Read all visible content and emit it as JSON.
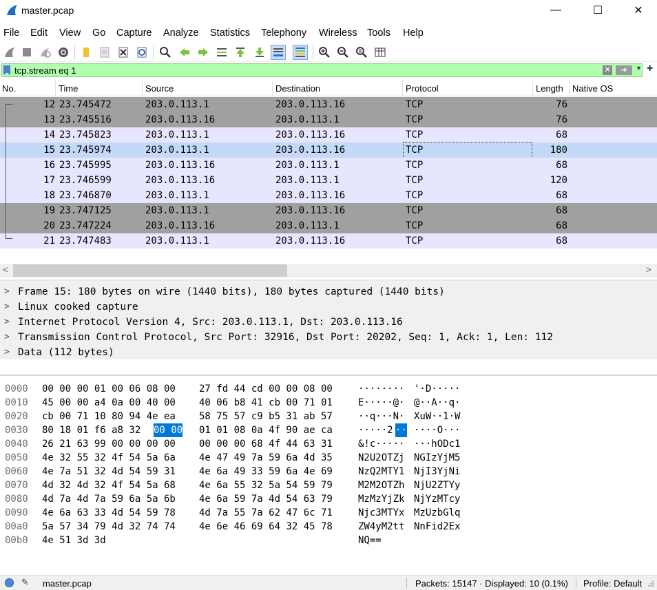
{
  "window": {
    "title": "master.pcap",
    "minimize": "—",
    "maximize": "☐",
    "close": "✕"
  },
  "menu": [
    "File",
    "Edit",
    "View",
    "Go",
    "Capture",
    "Analyze",
    "Statistics",
    "Telephony",
    "Wireless",
    "Tools",
    "Help"
  ],
  "filter": {
    "value": "tcp.stream eq 1"
  },
  "columns": [
    "No.",
    "Time",
    "Source",
    "Destination",
    "Protocol",
    "Length",
    "Native OS"
  ],
  "packets": [
    {
      "no": "12",
      "time": "23.745472",
      "src": "203.0.113.1",
      "dst": "203.0.113.16",
      "proto": "TCP",
      "len": "76"
    },
    {
      "no": "13",
      "time": "23.745516",
      "src": "203.0.113.16",
      "dst": "203.0.113.1",
      "proto": "TCP",
      "len": "76"
    },
    {
      "no": "14",
      "time": "23.745823",
      "src": "203.0.113.1",
      "dst": "203.0.113.16",
      "proto": "TCP",
      "len": "68"
    },
    {
      "no": "15",
      "time": "23.745974",
      "src": "203.0.113.1",
      "dst": "203.0.113.16",
      "proto": "TCP",
      "len": "180"
    },
    {
      "no": "16",
      "time": "23.745995",
      "src": "203.0.113.16",
      "dst": "203.0.113.1",
      "proto": "TCP",
      "len": "68"
    },
    {
      "no": "17",
      "time": "23.746599",
      "src": "203.0.113.16",
      "dst": "203.0.113.1",
      "proto": "TCP",
      "len": "120"
    },
    {
      "no": "18",
      "time": "23.746870",
      "src": "203.0.113.1",
      "dst": "203.0.113.16",
      "proto": "TCP",
      "len": "68"
    },
    {
      "no": "19",
      "time": "23.747125",
      "src": "203.0.113.1",
      "dst": "203.0.113.16",
      "proto": "TCP",
      "len": "68"
    },
    {
      "no": "20",
      "time": "23.747224",
      "src": "203.0.113.16",
      "dst": "203.0.113.1",
      "proto": "TCP",
      "len": "68"
    },
    {
      "no": "21",
      "time": "23.747483",
      "src": "203.0.113.1",
      "dst": "203.0.113.16",
      "proto": "TCP",
      "len": "68"
    }
  ],
  "details": [
    "Frame 15: 180 bytes on wire (1440 bits), 180 bytes captured (1440 bits)",
    "Linux cooked capture",
    "Internet Protocol Version 4, Src: 203.0.113.1, Dst: 203.0.113.16",
    "Transmission Control Protocol, Src Port: 32916, Dst Port: 20202, Seq: 1, Ack: 1, Len: 112",
    "Data (112 bytes)"
  ],
  "hex": [
    {
      "off": "0000",
      "b1": "00 00 00 01 00 06 08 00",
      "b2": "27 fd 44 cd 00 00 08 00",
      "a1": "········",
      "a2": "'·D·····"
    },
    {
      "off": "0010",
      "b1": "45 00 00 a4 0a 00 40 00",
      "b2": "40 06 b8 41 cb 00 71 01",
      "a1": "E·····@·",
      "a2": "@··A··q·"
    },
    {
      "off": "0020",
      "b1": "cb 00 71 10 80 94 4e ea",
      "b2": "58 75 57 c9 b5 31 ab 57",
      "a1": "··q···N·",
      "a2": "XuW··1·W"
    },
    {
      "off": "0030",
      "b1a": "80 18 01 f6 a8 32 ",
      "b1h": "00 00",
      "b2": "01 01 08 0a 4f 90 ae ca",
      "a1a": "·····2",
      "a1h": "··",
      "a2": "····O···"
    },
    {
      "off": "0040",
      "b1": "26 21 63 99 00 00 00 00",
      "b2": "00 00 00 68 4f 44 63 31",
      "a1": "&!c·····",
      "a2": "···hODc1"
    },
    {
      "off": "0050",
      "b1": "4e 32 55 32 4f 54 5a 6a",
      "b2": "4e 47 49 7a 59 6a 4d 35",
      "a1": "N2U2OTZj",
      "a2": "NGIzYjM5"
    },
    {
      "off": "0060",
      "b1": "4e 7a 51 32 4d 54 59 31",
      "b2": "4e 6a 49 33 59 6a 4e 69",
      "a1": "NzQ2MTY1",
      "a2": "NjI3YjNi"
    },
    {
      "off": "0070",
      "b1": "4d 32 4d 32 4f 54 5a 68",
      "b2": "4e 6a 55 32 5a 54 59 79",
      "a1": "M2M2OTZh",
      "a2": "NjU2ZTYy"
    },
    {
      "off": "0080",
      "b1": "4d 7a 4d 7a 59 6a 5a 6b",
      "b2": "4e 6a 59 7a 4d 54 63 79",
      "a1": "MzMzYjZk",
      "a2": "NjYzMTcy"
    },
    {
      "off": "0090",
      "b1": "4e 6a 63 33 4d 54 59 78",
      "b2": "4d 7a 55 7a 62 47 6c 71",
      "a1": "Njc3MTYx",
      "a2": "MzUzbGlq"
    },
    {
      "off": "00a0",
      "b1": "5a 57 34 79 4d 32 74 74",
      "b2": "4e 6e 46 69 64 32 45 78",
      "a1": "ZW4yM2tt",
      "a2": "NnFid2Ex"
    },
    {
      "off": "00b0",
      "b1": "4e 51 3d 3d",
      "b2": "",
      "a1": "NQ==",
      "a2": ""
    }
  ],
  "status": {
    "file": "master.pcap",
    "packets": "Packets: 15147 · Displayed: 10 (0.1%)",
    "profile": "Profile: Default"
  },
  "colors": {
    "row_dark": "#a0a0a0",
    "row_light": "#e7e6ff",
    "row_selected": "#c4d9f7",
    "filter_ok": "#afffaf",
    "hex_highlight": "#0078d7"
  }
}
